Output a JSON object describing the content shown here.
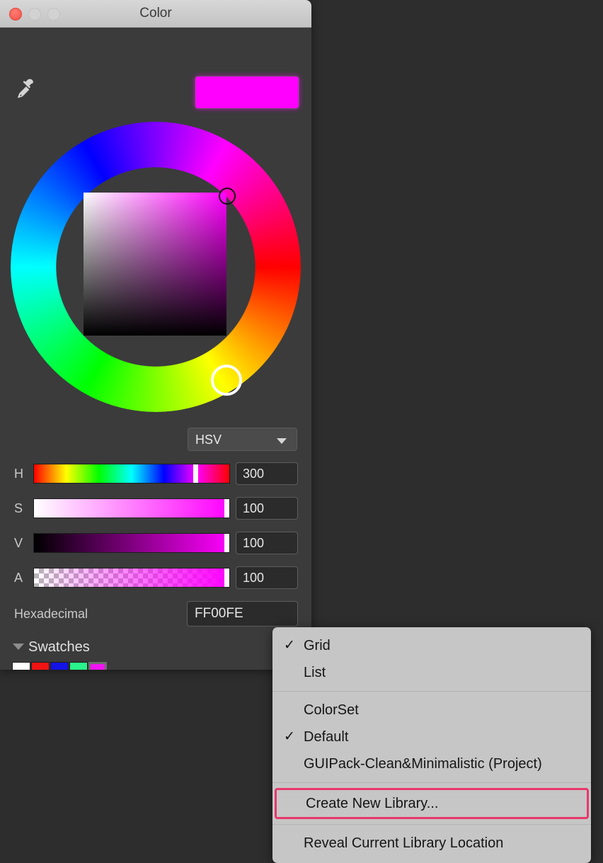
{
  "window": {
    "title": "Color",
    "traffic_lights": [
      {
        "name": "close",
        "color": "#f0524a",
        "active": true
      },
      {
        "name": "minimize",
        "color": "#d2d2d2",
        "active": false
      },
      {
        "name": "maximize",
        "color": "#d2d2d2",
        "active": false
      }
    ]
  },
  "toolbar": {
    "eyedropper_icon": "eyedropper-icon",
    "preview_color": "#FF00FE"
  },
  "wheel": {
    "selected_hue_color": "#FF00FE",
    "sv_gradient_base": "#FF00FE"
  },
  "mode": {
    "selected": "HSV",
    "caret_icon": "chevron-down-icon"
  },
  "sliders": [
    {
      "label": "H",
      "value": "300",
      "type": "hue",
      "handle_pct": 83.3
    },
    {
      "label": "S",
      "value": "100",
      "type": "saturation",
      "handle_pct": 100
    },
    {
      "label": "V",
      "value": "100",
      "type": "value",
      "handle_pct": 100
    },
    {
      "label": "A",
      "value": "100",
      "type": "alpha",
      "handle_pct": 100
    }
  ],
  "hex": {
    "label": "Hexadecimal",
    "value": "FF00FE"
  },
  "swatches": {
    "header": "Swatches",
    "disclosure_icon": "triangle-down-icon",
    "kebab_icon": "kebab-menu-icon",
    "colors": [
      {
        "name": "white",
        "hex": "#FFFFFF",
        "selected": false
      },
      {
        "name": "red",
        "hex": "#F21414",
        "selected": false
      },
      {
        "name": "blue",
        "hex": "#1414E6",
        "selected": false
      },
      {
        "name": "spring-green",
        "hex": "#2AF58C",
        "selected": false
      },
      {
        "name": "magenta",
        "hex": "#F214F2",
        "selected": true
      }
    ]
  },
  "context_menu": {
    "accent_color": "#E8386B",
    "groups": [
      {
        "items": [
          {
            "label": "Grid",
            "checked": true
          },
          {
            "label": "List",
            "checked": false
          }
        ]
      },
      {
        "items": [
          {
            "label": "ColorSet",
            "checked": false
          },
          {
            "label": "Default",
            "checked": true
          },
          {
            "label": "GUIPack-Clean&Minimalistic (Project)",
            "checked": false
          }
        ]
      },
      {
        "items": [
          {
            "label": "Create New Library...",
            "checked": false,
            "highlighted": true
          }
        ]
      },
      {
        "items": [
          {
            "label": "Reveal Current Library Location",
            "checked": false
          }
        ]
      }
    ],
    "check_glyph": "✓"
  }
}
